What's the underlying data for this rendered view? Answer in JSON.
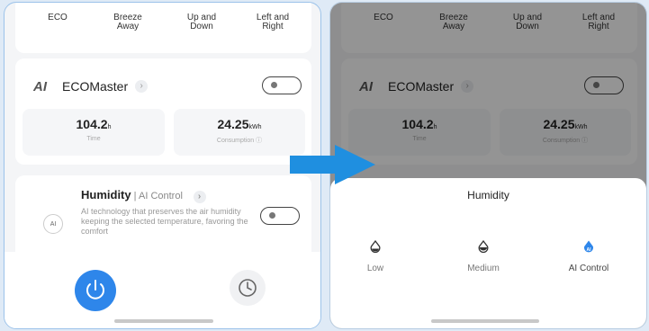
{
  "modes": [
    "ECO",
    "Breeze\nAway",
    "Up and\nDown",
    "Left and\nRight"
  ],
  "eco_master": {
    "logo": "AI",
    "title": "ECOMaster",
    "chevron": "›",
    "time_value": "104.2",
    "time_unit": "h",
    "time_label": "Time",
    "consumption_value": "24.25",
    "consumption_unit": "kWh",
    "consumption_label": "Consumption ⓘ"
  },
  "humidity_card": {
    "icon_label": "AI",
    "title": "Humidity",
    "separator": " | ",
    "subtitle": "AI Control",
    "chevron": "›",
    "description": "AI technology that preserves the air humidity keeping the selected temperature, favoring the comfort"
  },
  "bottom_bar": {
    "power_icon": "power-icon",
    "schedule_icon": "clock-icon"
  },
  "humidity_sheet": {
    "title": "Humidity",
    "options": [
      {
        "label": "Low",
        "icon": "drop-low-icon"
      },
      {
        "label": "Medium",
        "icon": "drop-medium-icon"
      },
      {
        "label": "AI Control",
        "icon": "drop-ai-icon",
        "active": true
      }
    ]
  },
  "colors": {
    "accent": "#2e86ea",
    "arrow": "#1f8fe0",
    "overlay": "rgba(0,0,0,0.42)"
  }
}
